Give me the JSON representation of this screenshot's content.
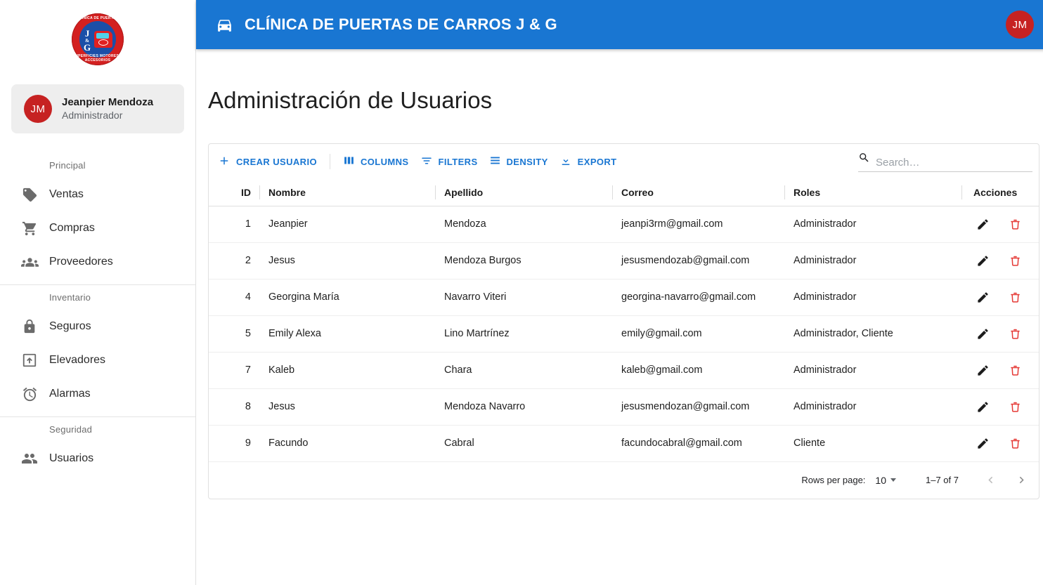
{
  "sidebar": {
    "logo": {
      "icon": "clinic-logo",
      "ring_text_top": "CLÍNICA DE PUERTAS",
      "ring_text_bottom": "SUPERFICIES MOTORES Y ACCESORIOS",
      "monogram": "J",
      "monogram_amp": "&",
      "monogram_g": "G"
    },
    "profile": {
      "initials": "JM",
      "name": "Jeanpier Mendoza",
      "role": "Administrador"
    },
    "sections": [
      {
        "label": "Principal",
        "items": [
          {
            "label": "Ventas",
            "icon": "tag-icon"
          },
          {
            "label": "Compras",
            "icon": "shopping-cart-icon"
          },
          {
            "label": "Proveedores",
            "icon": "groups-icon"
          }
        ]
      },
      {
        "label": "Inventario",
        "items": [
          {
            "label": "Seguros",
            "icon": "lock-icon"
          },
          {
            "label": "Elevadores",
            "icon": "elevator-icon"
          },
          {
            "label": "Alarmas",
            "icon": "alarm-icon"
          }
        ]
      },
      {
        "label": "Seguridad",
        "items": [
          {
            "label": "Usuarios",
            "icon": "people-icon"
          }
        ]
      }
    ]
  },
  "topbar": {
    "icon": "car-door-icon",
    "title": "CLÍNICA DE PUERTAS DE CARROS J & G",
    "avatar_initials": "JM",
    "background_color": "#1976d2",
    "avatar_color": "#c62222"
  },
  "page": {
    "title": "Administración de Usuarios"
  },
  "toolbar": {
    "create_label": "CREAR USUARIO",
    "columns_label": "COLUMNS",
    "filters_label": "FILTERS",
    "density_label": "DENSITY",
    "export_label": "EXPORT",
    "accent_color": "#1976d2"
  },
  "search": {
    "placeholder": "Search…",
    "value": "",
    "icon": "search-icon"
  },
  "table": {
    "columns": [
      {
        "key": "id",
        "label": "ID"
      },
      {
        "key": "nombre",
        "label": "Nombre"
      },
      {
        "key": "apellido",
        "label": "Apellido"
      },
      {
        "key": "correo",
        "label": "Correo"
      },
      {
        "key": "roles",
        "label": "Roles"
      },
      {
        "key": "acciones",
        "label": "Acciones"
      }
    ],
    "rows": [
      {
        "id": "1",
        "nombre": "Jeanpier",
        "apellido": "Mendoza",
        "correo": "jeanpi3rm@gmail.com",
        "roles": "Administrador"
      },
      {
        "id": "2",
        "nombre": "Jesus",
        "apellido": "Mendoza Burgos",
        "correo": "jesusmendozab@gmail.com",
        "roles": "Administrador"
      },
      {
        "id": "4",
        "nombre": "Georgina María",
        "apellido": "Navarro Viteri",
        "correo": "georgina-navarro@gmail.com",
        "roles": "Administrador"
      },
      {
        "id": "5",
        "nombre": "Emily Alexa",
        "apellido": "Lino Martrínez",
        "correo": "emily@gmail.com",
        "roles": "Administrador, Cliente"
      },
      {
        "id": "7",
        "nombre": "Kaleb",
        "apellido": "Chara",
        "correo": "kaleb@gmail.com",
        "roles": "Administrador"
      },
      {
        "id": "8",
        "nombre": "Jesus",
        "apellido": "Mendoza Navarro",
        "correo": "jesusmendozan@gmail.com",
        "roles": "Administrador"
      },
      {
        "id": "9",
        "nombre": "Facundo",
        "apellido": "Cabral",
        "correo": "facundocabral@gmail.com",
        "roles": "Cliente"
      }
    ],
    "row_actions": {
      "edit_icon": "edit-pencil-icon",
      "delete_icon": "delete-trash-icon",
      "delete_color": "#e53935"
    }
  },
  "pagination": {
    "rows_per_page_label": "Rows per page:",
    "rows_per_page_value": "10",
    "range_label": "1–7 of 7",
    "prev_icon": "chevron-left-icon",
    "next_icon": "chevron-right-icon"
  }
}
